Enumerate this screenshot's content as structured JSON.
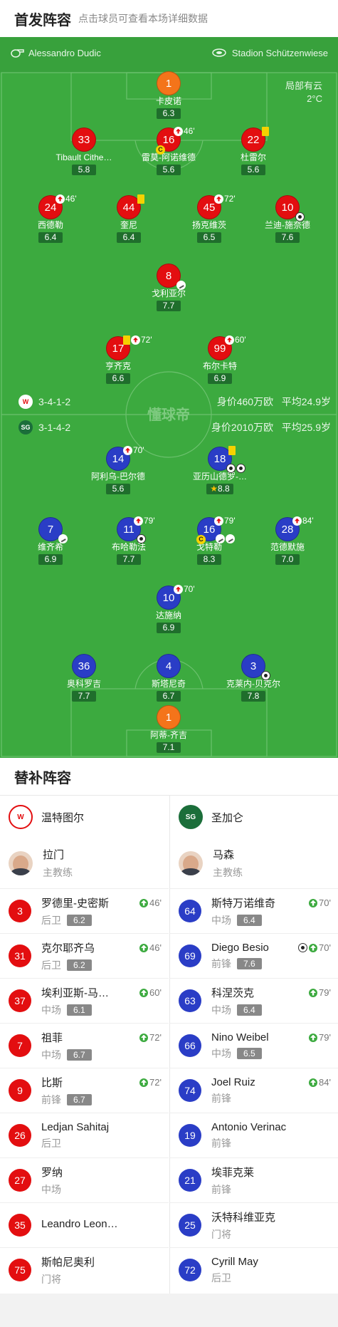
{
  "header": {
    "title": "首发阵容",
    "subtitle": "点击球员可查看本场详细数据"
  },
  "referee": "Alessandro Dudic",
  "stadium": "Stadion Schützenwiese",
  "weather": {
    "text": "局部有云",
    "temp": "2°C"
  },
  "watermark": "懂球帝",
  "home": {
    "formation": "3-4-1-2",
    "value": "身价460万欧",
    "age": "平均24.9岁",
    "players": [
      {
        "num": "1",
        "name": "卡皮诺",
        "rating": "6.3"
      },
      {
        "num": "33",
        "name": "Tibault Cithe…",
        "rating": "5.8"
      },
      {
        "num": "16",
        "name": "雷莫-阿诺维德",
        "rating": "5.6",
        "minute": "46'"
      },
      {
        "num": "22",
        "name": "杜雷尔",
        "rating": "5.6"
      },
      {
        "num": "24",
        "name": "西德勒",
        "rating": "6.4",
        "minute": "46'"
      },
      {
        "num": "44",
        "name": "奎尼",
        "rating": "6.4"
      },
      {
        "num": "45",
        "name": "扬克维茨",
        "rating": "6.5",
        "minute": "72'"
      },
      {
        "num": "10",
        "name": "兰迪-施奈德",
        "rating": "7.6"
      },
      {
        "num": "8",
        "name": "戈利亚尔",
        "rating": "7.7"
      },
      {
        "num": "17",
        "name": "亨齐克",
        "rating": "6.6",
        "minute": "72'"
      },
      {
        "num": "99",
        "name": "布尔卡特",
        "rating": "6.9",
        "minute": "60'"
      }
    ]
  },
  "away": {
    "formation": "3-1-4-2",
    "value": "身价2010万欧",
    "age": "平均25.9岁",
    "players": [
      {
        "num": "14",
        "name": "阿利乌-巴尔德",
        "rating": "5.6",
        "minute": "70'"
      },
      {
        "num": "18",
        "name": "亚历山德罗-…",
        "rating": "8.8"
      },
      {
        "num": "7",
        "name": "维齐希",
        "rating": "6.9"
      },
      {
        "num": "11",
        "name": "布哈勒法",
        "rating": "7.7",
        "minute": "79'"
      },
      {
        "num": "16",
        "name": "戈特勒",
        "rating": "8.3",
        "minute": "79'"
      },
      {
        "num": "28",
        "name": "范德默施",
        "rating": "7.0",
        "minute": "84'"
      },
      {
        "num": "10",
        "name": "达施纳",
        "rating": "6.9",
        "minute": "70'"
      },
      {
        "num": "36",
        "name": "奥科罗吉",
        "rating": "7.7"
      },
      {
        "num": "4",
        "name": "斯塔尼奇",
        "rating": "6.7"
      },
      {
        "num": "3",
        "name": "克莱内-贝克尔",
        "rating": "7.8"
      },
      {
        "num": "1",
        "name": "阿蒂-齐吉",
        "rating": "7.1"
      }
    ]
  },
  "subs_title": "替补阵容",
  "subs": {
    "home": {
      "team": "温特图尔",
      "coach": {
        "name": "拉门",
        "role": "主教练"
      },
      "list": [
        {
          "num": "3",
          "name": "罗德里-史密斯",
          "pos": "后卫",
          "rating": "6.2",
          "minute": "46'"
        },
        {
          "num": "31",
          "name": "克尔耶齐乌",
          "pos": "后卫",
          "rating": "6.2",
          "minute": "46'"
        },
        {
          "num": "37",
          "name": "埃利亚斯-马…",
          "pos": "中场",
          "rating": "6.1",
          "minute": "60'"
        },
        {
          "num": "7",
          "name": "祖菲",
          "pos": "中场",
          "rating": "6.7",
          "minute": "72'"
        },
        {
          "num": "9",
          "name": "比斯",
          "pos": "前锋",
          "rating": "6.7",
          "minute": "72'"
        },
        {
          "num": "26",
          "name": "Ledjan Sahitaj",
          "pos": "后卫"
        },
        {
          "num": "27",
          "name": "罗纳",
          "pos": "中场"
        },
        {
          "num": "35",
          "name": "Leandro Leon…",
          "pos": ""
        },
        {
          "num": "75",
          "name": "斯帕尼奥利",
          "pos": "门将"
        }
      ]
    },
    "away": {
      "team": "圣加仑",
      "coach": {
        "name": "马森",
        "role": "主教练"
      },
      "list": [
        {
          "num": "64",
          "name": "斯特万诺维奇",
          "pos": "中场",
          "rating": "6.4",
          "minute": "70'"
        },
        {
          "num": "69",
          "name": "Diego Besio",
          "pos": "前锋",
          "rating": "7.6",
          "minute": "70'"
        },
        {
          "num": "63",
          "name": "科涅茨克",
          "pos": "中场",
          "rating": "6.4",
          "minute": "79'"
        },
        {
          "num": "66",
          "name": "Nino Weibel",
          "pos": "中场",
          "rating": "6.5",
          "minute": "79'"
        },
        {
          "num": "74",
          "name": "Joel Ruiz",
          "pos": "前锋",
          "minute": "84'"
        },
        {
          "num": "19",
          "name": "Antonio Verinac",
          "pos": "前锋"
        },
        {
          "num": "21",
          "name": "埃菲克莱",
          "pos": "前锋"
        },
        {
          "num": "25",
          "name": "沃特科维亚克",
          "pos": "门将"
        },
        {
          "num": "72",
          "name": "Cyrill May",
          "pos": "后卫"
        }
      ]
    }
  },
  "colors": {
    "pitch": "#3caa3f",
    "home": "#e30e10",
    "away": "#2a3dc6",
    "keeper_home": "#f4741a"
  }
}
